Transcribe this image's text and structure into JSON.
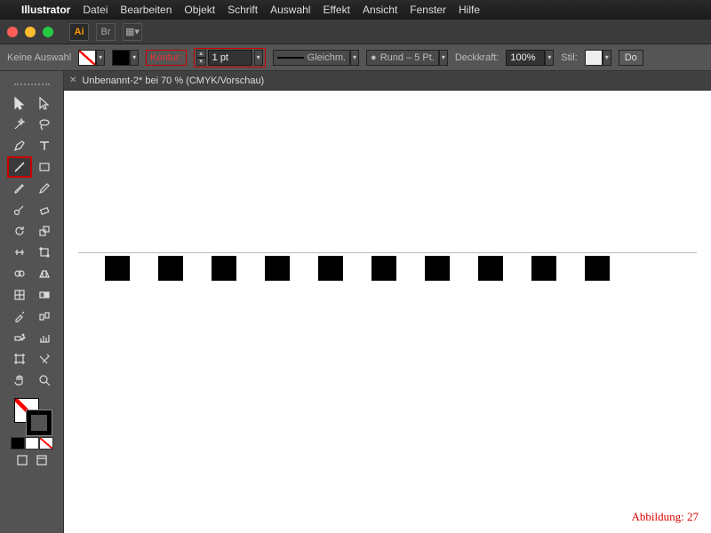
{
  "menubar": {
    "app": "Illustrator",
    "items": [
      "Datei",
      "Bearbeiten",
      "Objekt",
      "Schrift",
      "Auswahl",
      "Effekt",
      "Ansicht",
      "Fenster",
      "Hilfe"
    ]
  },
  "winbar": {
    "ai": "Ai",
    "br": "Br"
  },
  "ctrlbar": {
    "selection": "Keine Auswahl",
    "stroke_label": "Kontur:",
    "stroke_val": "1 pt",
    "linestyle": "Gleichm.",
    "brush": "Rund – 5 Pt.",
    "opacity_label": "Deckkraft:",
    "opacity_val": "100%",
    "style_label": "Stil:",
    "end_btn": "Do"
  },
  "tab": {
    "title": "Unbenannt-2* bei 70 % (CMYK/Vorschau)"
  },
  "tools": [
    [
      "selection",
      "direct-select"
    ],
    [
      "magic-wand",
      "lasso"
    ],
    [
      "pen",
      "type"
    ],
    [
      "line",
      "rectangle"
    ],
    [
      "brush",
      "pencil"
    ],
    [
      "blob",
      "eraser"
    ],
    [
      "rotate",
      "scale"
    ],
    [
      "width",
      "free-transform"
    ],
    [
      "shape-builder",
      "perspective"
    ],
    [
      "mesh",
      "gradient"
    ],
    [
      "eyedropper",
      "blend"
    ],
    [
      "symbol-spray",
      "graph"
    ],
    [
      "artboard",
      "slice"
    ],
    [
      "hand",
      "zoom"
    ]
  ],
  "canvas": {
    "squares": 10
  },
  "figcap": "Abbildung: 27",
  "colors": {
    "accent": "#c00"
  }
}
